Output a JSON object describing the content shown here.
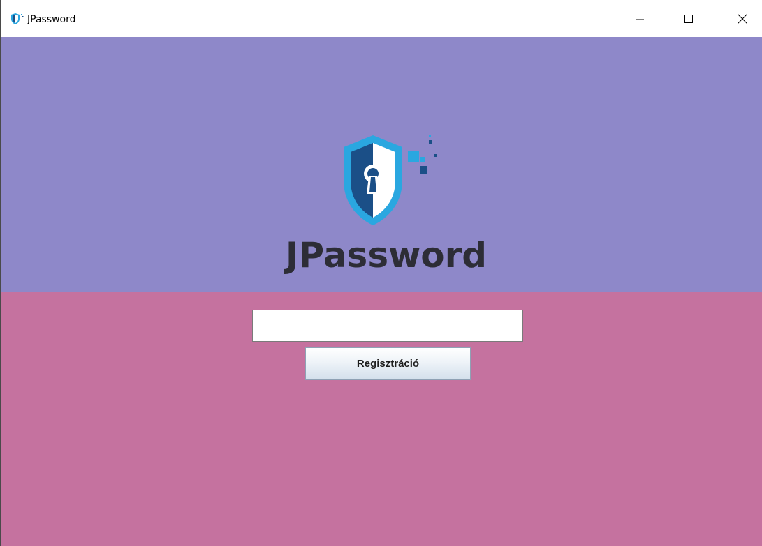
{
  "window": {
    "title": "JPassword",
    "controls": {
      "minimize": "minimize-icon",
      "maximize": "maximize-icon",
      "close": "close-icon"
    }
  },
  "hero": {
    "logo_icon": "shield-keyhole-icon",
    "brand_text": "JPassword"
  },
  "form": {
    "input_value": "",
    "input_placeholder": "",
    "register_label": "Regisztráció"
  },
  "colors": {
    "hero_background": "#8e88c9",
    "panel_background": "#c5729f",
    "brand_text": "#2d2d36",
    "shield_dark": "#1b4f87",
    "shield_light": "#2aa7e0"
  }
}
